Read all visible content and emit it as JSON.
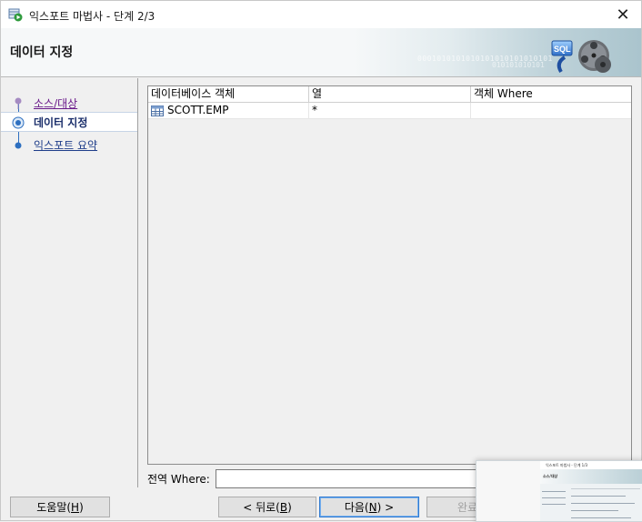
{
  "window": {
    "title": "익스포트 마법사 - 단계 2/3",
    "close_glyph": "✕"
  },
  "banner": {
    "title": "데이터 지정",
    "binary_text": "0001010101010101010101010101",
    "binary_text2": "010101010101"
  },
  "nav": {
    "items": [
      {
        "label": "소스/대상",
        "state": "visited"
      },
      {
        "label": "데이터 지정",
        "state": "active"
      },
      {
        "label": "익스포트 요약",
        "state": "link"
      }
    ]
  },
  "grid": {
    "columns": [
      "데이터베이스 객체",
      "열",
      "객체 Where"
    ],
    "rows": [
      {
        "object": "SCOTT.EMP",
        "columns": "*",
        "where": "",
        "icon": "table-icon"
      }
    ]
  },
  "where": {
    "label": "전역 Where:",
    "value": ""
  },
  "buttons": {
    "help": "도움말(H)",
    "help_pre": "도움말(",
    "help_key": "H",
    "help_post": ")",
    "back_pre": "< 뒤로(",
    "back_key": "B",
    "back_post": ")",
    "next_pre": "다음(",
    "next_key": "N",
    "next_post": ") >",
    "finish": "완료"
  },
  "thumbnail": {
    "title": "익스포트 마법사 - 단계 1/3",
    "banner": "소스/대상"
  },
  "colors": {
    "accent": "#2f79d0",
    "nav_line": "#2d6fc0",
    "link": "#1f3e8a",
    "visited": "#6a1a8a"
  }
}
